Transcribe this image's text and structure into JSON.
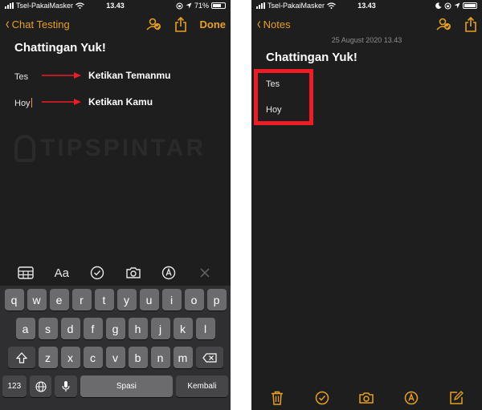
{
  "left": {
    "status": {
      "carrier": "Tsel-PakaiMasker",
      "time": "13.43",
      "battery": "71%"
    },
    "nav": {
      "back_label": "Chat Testing",
      "done_label": "Done"
    },
    "note": {
      "title": "Chattingan Yuk!",
      "line1": "Tes",
      "line2": "Hoy"
    },
    "annotations": {
      "arrow1_label": "Ketikan Temanmu",
      "arrow2_label": "Ketikan Kamu"
    },
    "watermark": "TIPSPINTAR",
    "format_toolbar": {
      "text_style_label": "Aa"
    },
    "keyboard": {
      "row1": [
        "q",
        "w",
        "e",
        "r",
        "t",
        "y",
        "u",
        "i",
        "o",
        "p"
      ],
      "row2": [
        "a",
        "s",
        "d",
        "f",
        "g",
        "h",
        "j",
        "k",
        "l"
      ],
      "row3": [
        "z",
        "x",
        "c",
        "v",
        "b",
        "n",
        "m"
      ],
      "numbers_label": "123",
      "space_label": "Spasi",
      "return_label": "Kembali"
    }
  },
  "right": {
    "status": {
      "carrier": "Tsel-PakaiMasker",
      "time": "13.43"
    },
    "nav": {
      "back_label": "Notes"
    },
    "note": {
      "date": "25 August 2020 13.43",
      "title": "Chattingan Yuk!",
      "line1": "Tes",
      "line2": "Hoy"
    }
  },
  "colors": {
    "accent": "#e7a11b",
    "background": "#1e1e1e",
    "annotation_red": "#ee1c24"
  }
}
